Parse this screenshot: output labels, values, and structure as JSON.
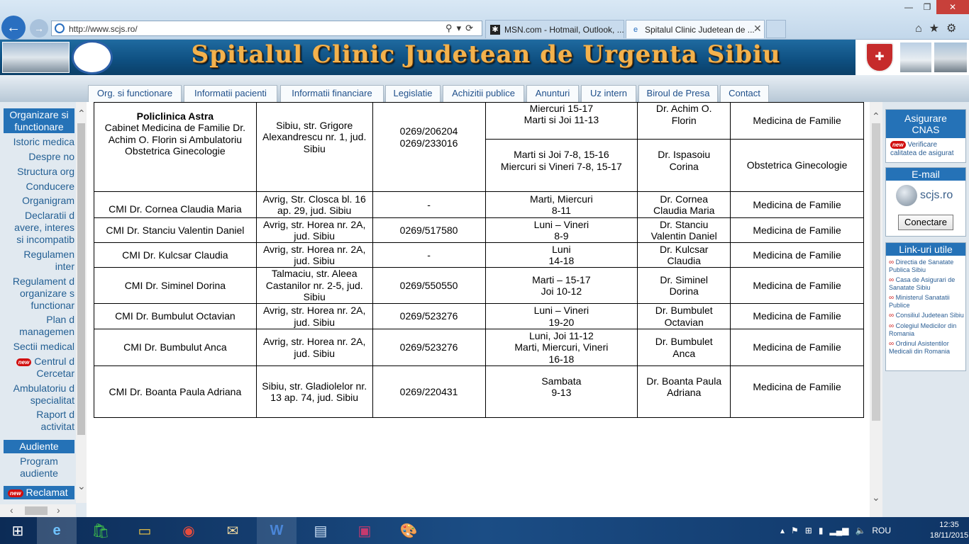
{
  "browser": {
    "url": "http://www.scjs.ro/",
    "tabs": [
      {
        "title": "MSN.com - Hotmail, Outlook, ..."
      },
      {
        "title": "Spitalul Clinic Judetean de ..."
      }
    ],
    "close_tab_glyph": "✕",
    "window_controls": [
      "—",
      "❐",
      "✕"
    ]
  },
  "banner": {
    "title": "Spitalul Clinic Judetean de Urgenta Sibiu"
  },
  "nav": [
    "Org. si functionare",
    "Informatii pacienti",
    "Informatii financiare",
    "Legislatie",
    "Achizitii publice",
    "Anunturi",
    "Uz intern",
    "Biroul de Presa",
    "Contact"
  ],
  "left_menu": {
    "header1": "Organizare si functionare",
    "items": [
      "Istoric medical",
      "Despre noi",
      "Structura org",
      "Conducere",
      "Organigram",
      "Declaratii de avere, interese si incompatibilitati",
      "Regulament intern",
      "Regulament de organizare si functionare",
      "Plan de management",
      "Sectii medicale",
      "Centrul de Cercetare",
      "Ambulatoriu de specialitate",
      "Raport de activitate"
    ],
    "item_lines": {
      "declaratii": [
        "Declaratii d",
        "avere, interes",
        "si incompatib"
      ],
      "reg_intern": [
        "Regulamen",
        "inter"
      ],
      "reg_org": [
        "Regulament d",
        "organizare s",
        "functionar"
      ],
      "plan": [
        "Plan d",
        "managemen"
      ],
      "centrul": [
        "Centrul d",
        "Cercetar"
      ],
      "ambul": [
        "Ambulatoriu d",
        "specialitat"
      ],
      "raport": [
        "Raport d",
        "activitat"
      ]
    },
    "visible_items": [
      "Istoric medica",
      "Despre no",
      "Structura org",
      "Conducere",
      "Organigram",
      "Sectii medical"
    ],
    "header2": "Audiente",
    "audiente_sub": "Program audiente",
    "reclamatii": "Reclamat",
    "new_label": "new"
  },
  "table": {
    "rows": [
      {
        "name_bold": "Policlinica Astra",
        "name": "Cabinet Medicina de Familie Dr. Achim O. Florin si Ambulatoriu Obstetrica Ginecologie",
        "address": "Sibiu, str. Grigore Alexandrescu nr. 1, jud. Sibiu",
        "phone": "0269/206204\n0269/233016",
        "sub": [
          {
            "schedule": "Miercuri 15-17\nMarti si Joi 11-13",
            "doctor": "Dr. Achim O.\nFlorin",
            "spec": "Medicina de Familie"
          },
          {
            "schedule": "Marti si Joi 7-8, 15-16\nMiercuri si Vineri 7-8, 15-17",
            "doctor": "Dr. Ispasoiu\nCorina",
            "spec": "Obstetrica Ginecologie"
          }
        ]
      },
      {
        "name": "CMI Dr. Cornea Claudia Maria",
        "address": "Avrig, Str. Closca bl. 16 ap. 29, jud. Sibiu",
        "phone": "-",
        "schedule": "Marti, Miercuri\n8-11",
        "doctor": "Dr. Cornea\nClaudia Maria",
        "spec": "Medicina de Familie"
      },
      {
        "name": "CMI Dr. Stanciu Valentin Daniel",
        "address": "Avrig, str. Horea nr. 2A, jud. Sibiu",
        "phone": "0269/517580",
        "schedule": "Luni – Vineri\n8-9",
        "doctor": "Dr. Stanciu\nValentin Daniel",
        "spec": "Medicina de Familie"
      },
      {
        "name": "CMI Dr. Kulcsar Claudia",
        "address": "Avrig, str. Horea nr. 2A, jud. Sibiu",
        "phone": "-",
        "schedule": "Luni\n14-18",
        "doctor": "Dr. Kulcsar\nClaudia",
        "spec": "Medicina de Familie"
      },
      {
        "name": "CMI Dr. Siminel Dorina",
        "address": "Talmaciu, str. Aleea Castanilor nr. 2-5, jud. Sibiu",
        "phone": "0269/550550",
        "schedule": "Marti – 15-17\nJoi 10-12",
        "doctor": "Dr. Siminel\nDorina",
        "spec": "Medicina de Familie"
      },
      {
        "name": "CMI Dr. Bumbulut Octavian",
        "address": "Avrig, str. Horea nr. 2A, jud. Sibiu",
        "phone": "0269/523276",
        "schedule": "Luni – Vineri\n19-20",
        "doctor": "Dr. Bumbulet\nOctavian",
        "spec": "Medicina de Familie"
      },
      {
        "name": "CMI Dr. Bumbulut Anca",
        "address": "Avrig, str. Horea nr. 2A, jud. Sibiu",
        "phone": "0269/523276",
        "schedule": "Luni, Joi 11-12\nMarti, Miercuri, Vineri\n16-18",
        "doctor": "Dr. Bumbulet\nAnca",
        "spec": "Medicina de Familie"
      },
      {
        "name": "CMI Dr. Boanta Paula Adriana",
        "address": "Sibiu, str. Gladiolelor nr. 13 ap. 74, jud. Sibiu",
        "phone": "0269/220431",
        "schedule": "Sambata\n9-13",
        "doctor": "Dr. Boanta Paula\nAdriana",
        "spec": "Medicina de Familie"
      }
    ]
  },
  "right_panel": {
    "cnas_title": "Asigurare CNAS",
    "cnas_link": "Verificare calitatea de asigurat",
    "email_title": "E-mail",
    "email_logo": "scjs.ro",
    "connect": "Conectare",
    "links_title": "Link-uri utile",
    "links": [
      "Directia de Sanatate Publica Sibiu",
      "Casa de Asigurari de Sanatate Sibiu",
      "Ministerul Sanatatii Publice",
      "Consiliul Judetean Sibiu",
      "Colegiul Medicilor din Romania",
      "Ordinul Asistentilor Medicali din Romania"
    ]
  },
  "taskbar": {
    "language": "ROU",
    "time": "12:35",
    "date": "18/11/2015",
    "apps": [
      "windows-logo",
      "internet-explorer",
      "store",
      "file-explorer",
      "chrome",
      "mail",
      "word",
      "notepad",
      "floppy",
      "paint"
    ]
  }
}
